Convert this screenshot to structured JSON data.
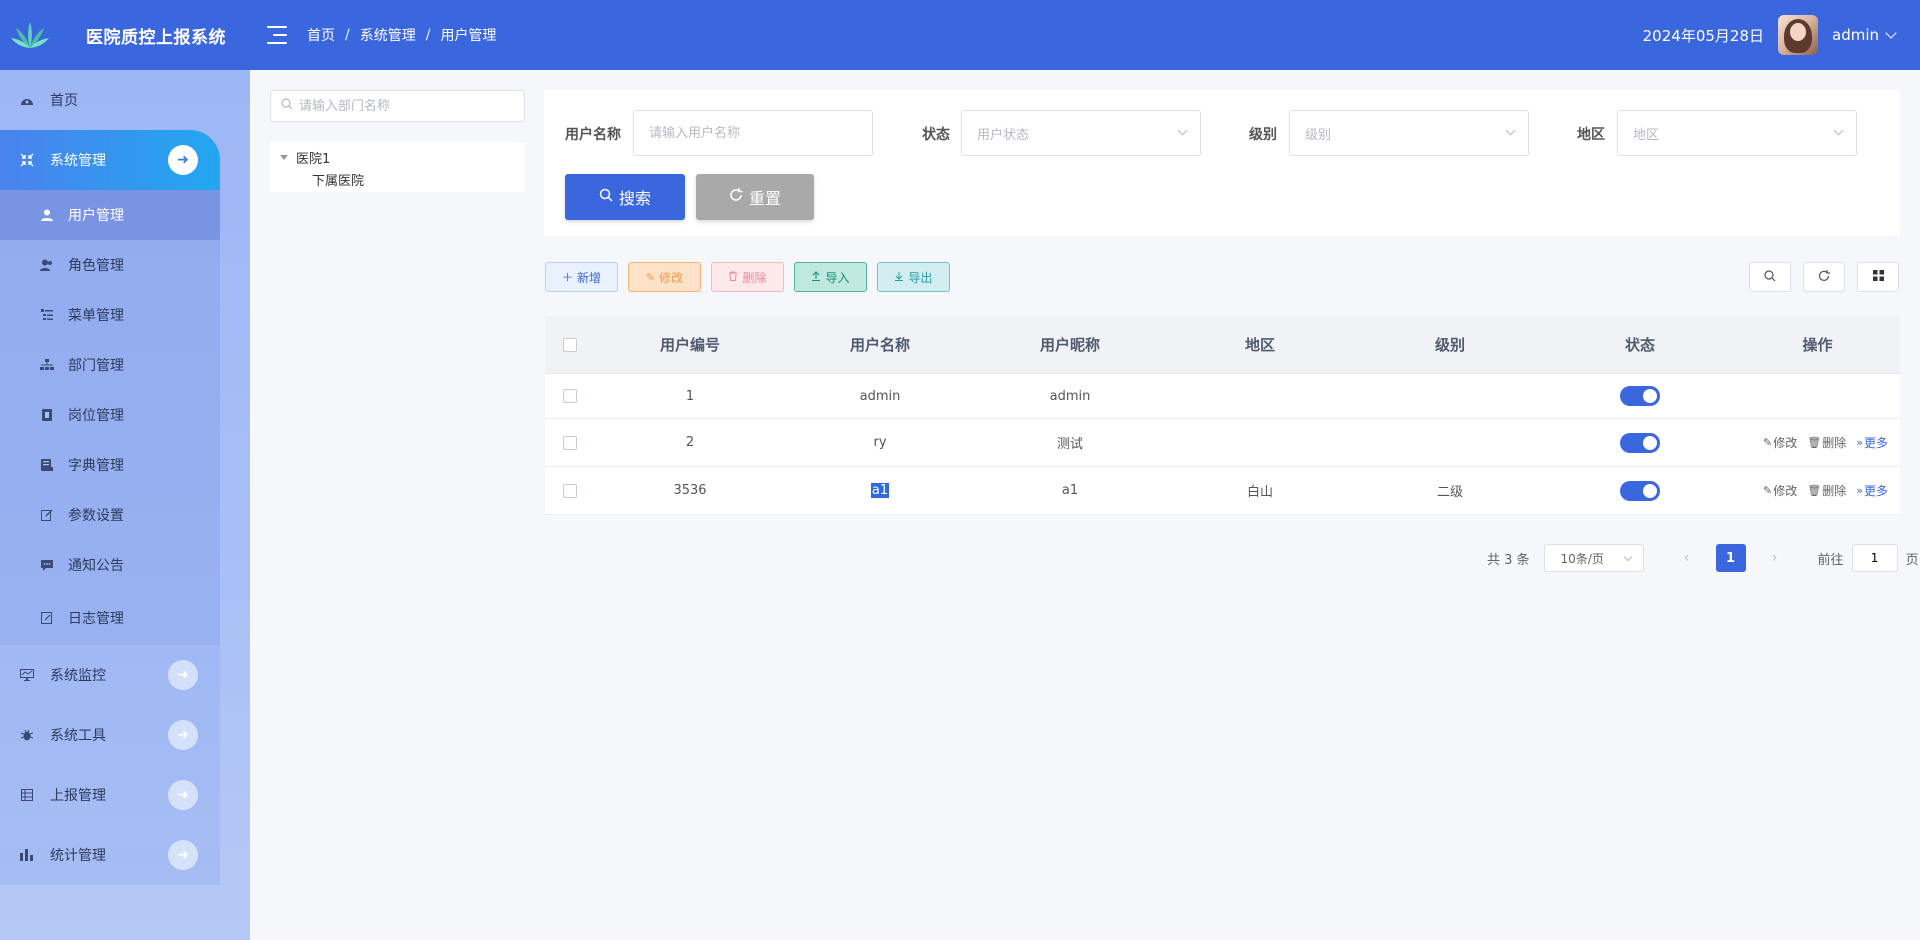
{
  "app": {
    "title": "医院质控上报系统"
  },
  "header": {
    "breadcrumb": [
      "首页",
      "系统管理",
      "用户管理"
    ],
    "breadcrumb_sep": "/",
    "date": "2024年05月28日",
    "username": "admin"
  },
  "sidebar": {
    "items": [
      {
        "label": "首页",
        "icon": "dashboard-icon"
      },
      {
        "label": "系统管理",
        "icon": "system-icon",
        "expanded": true
      },
      {
        "label": "系统监控",
        "icon": "monitor-icon"
      },
      {
        "label": "系统工具",
        "icon": "tool-icon"
      },
      {
        "label": "上报管理",
        "icon": "report-icon"
      },
      {
        "label": "统计管理",
        "icon": "chart-icon"
      }
    ],
    "subitems": [
      {
        "label": "用户管理",
        "icon": "user-icon",
        "active": true
      },
      {
        "label": "角色管理",
        "icon": "role-icon"
      },
      {
        "label": "菜单管理",
        "icon": "menu-tree-icon"
      },
      {
        "label": "部门管理",
        "icon": "org-icon"
      },
      {
        "label": "岗位管理",
        "icon": "post-icon"
      },
      {
        "label": "字典管理",
        "icon": "dict-icon"
      },
      {
        "label": "参数设置",
        "icon": "edit-icon"
      },
      {
        "label": "通知公告",
        "icon": "message-icon"
      },
      {
        "label": "日志管理",
        "icon": "log-icon"
      }
    ]
  },
  "dept_tree": {
    "search_placeholder": "请输入部门名称",
    "root": "医院1",
    "child": "下属医院"
  },
  "search_form": {
    "username_label": "用户名称",
    "username_placeholder": "请输入用户名称",
    "status_label": "状态",
    "status_placeholder": "用户状态",
    "level_label": "级别",
    "level_placeholder": "级别",
    "region_label": "地区",
    "region_placeholder": "地区",
    "search_button": "搜索",
    "reset_button": "重置"
  },
  "toolbar": {
    "add": "新增",
    "edit": "修改",
    "delete": "删除",
    "import": "导入",
    "export": "导出"
  },
  "table": {
    "columns": [
      "用户编号",
      "用户名称",
      "用户昵称",
      "地区",
      "级别",
      "状态",
      "操作"
    ],
    "rows": [
      {
        "id": "1",
        "name": "admin",
        "nickname": "admin",
        "region": "",
        "level": "",
        "enabled": true,
        "ops": []
      },
      {
        "id": "2",
        "name": "ry",
        "nickname": "测试",
        "region": "",
        "level": "",
        "enabled": true,
        "ops": [
          "修改",
          "删除",
          "更多"
        ]
      },
      {
        "id": "3536",
        "name": "a1",
        "nickname": "a1",
        "region": "白山",
        "level": "二级",
        "enabled": true,
        "ops": [
          "修改",
          "删除",
          "更多"
        ]
      }
    ]
  },
  "pagination": {
    "total_text": "共 3 条",
    "page_size": "10条/页",
    "current_page": "1",
    "goto_prefix": "前往",
    "goto_value": "1",
    "goto_suffix": "页"
  },
  "colors": {
    "primary": "#3a66de",
    "header_bg": "#3a66de",
    "sidebar_bg": "#a9c0f6"
  }
}
